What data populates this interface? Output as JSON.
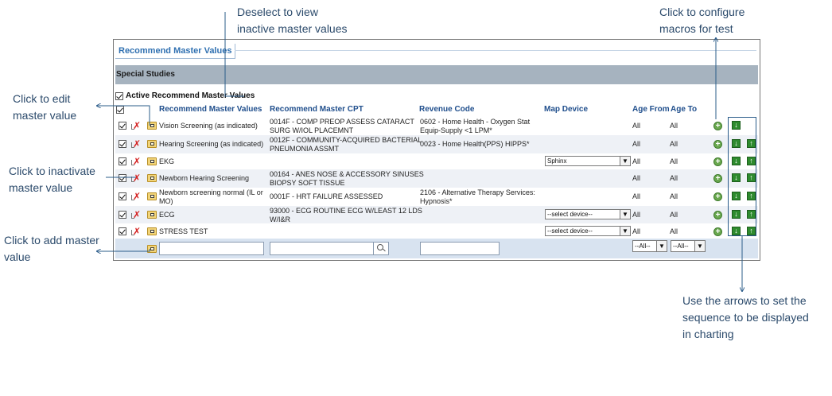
{
  "annotations": {
    "deselect": [
      "Deselect  to view",
      "inactive master values"
    ],
    "macros": [
      "Click to configure",
      "macros for test"
    ],
    "edit": [
      "Click to edit",
      "master value"
    ],
    "inactivate": [
      "Click to inactivate",
      "master value"
    ],
    "add": [
      "Click to add master",
      "value"
    ],
    "arrows": [
      "Use the arrows to set the",
      "sequence to be displayed",
      "in charting"
    ]
  },
  "panel": {
    "tab_title": "Recommend Master Values",
    "section_title": "Special Studies",
    "active_label": "Active Recommend Master Values"
  },
  "columns": {
    "values": "Recommend Master Values",
    "cpt": "Recommend Master CPT",
    "revenue": "Revenue Code",
    "device": "Map Device",
    "age_from": "Age From",
    "age_to": "Age To"
  },
  "rows": [
    {
      "name": "Vision Screening (as indicated)",
      "cpt": [
        "0014F - COMP PREOP ASSESS CATARACT",
        "SURG W/IOL PLACEMNT"
      ],
      "revenue": [
        "0602 - Home Health - Oxygen Stat",
        "Equip-Supply <1 LPM*"
      ],
      "device": "",
      "age_from": "All",
      "age_to": "All",
      "up": false,
      "down": true
    },
    {
      "name": "Hearing Screening (as indicated)",
      "cpt": [
        "0012F - COMMUNITY-ACQUIRED BACTERIAL",
        "PNEUMONIA ASSMT"
      ],
      "revenue": [
        "0023 - Home Health(PPS) HIPPS*",
        ""
      ],
      "device": "",
      "age_from": "All",
      "age_to": "All",
      "up": true,
      "down": true
    },
    {
      "name": "EKG",
      "cpt": [
        "",
        ""
      ],
      "revenue": [
        "",
        ""
      ],
      "device": "Sphinx",
      "age_from": "All",
      "age_to": "All",
      "up": true,
      "down": true
    },
    {
      "name": "Newborn Hearing Screening",
      "cpt": [
        "00164 - ANES NOSE & ACCESSORY SINUSES",
        "BIOPSY SOFT TISSUE"
      ],
      "revenue": [
        "",
        ""
      ],
      "device": "",
      "age_from": "All",
      "age_to": "All",
      "up": true,
      "down": true
    },
    {
      "name": "Newborn screening normal (IL or MO)",
      "cpt": [
        "0001F - HRT FAILURE ASSESSED",
        ""
      ],
      "revenue": [
        "2106 - Alternative Therapy Services:",
        "Hypnosis*"
      ],
      "device": "",
      "age_from": "All",
      "age_to": "All",
      "up": true,
      "down": true
    },
    {
      "name": "ECG",
      "cpt": [
        "93000 - ECG ROUTINE ECG W/LEAST 12 LDS",
        "W/I&R"
      ],
      "revenue": [
        "",
        ""
      ],
      "device": "--select device--",
      "age_from": "All",
      "age_to": "All",
      "up": true,
      "down": true
    },
    {
      "name": "STRESS TEST",
      "cpt": [
        "",
        ""
      ],
      "revenue": [
        "",
        ""
      ],
      "device": "--select device--",
      "age_from": "All",
      "age_to": "All",
      "up": true,
      "down": true
    }
  ],
  "add_row": {
    "age_from_default": "--All--",
    "age_to_default": "--All--"
  },
  "colors": {
    "accent": "#2f70b1",
    "header_bar": "#a6b3bf",
    "arrow_green": "#2e8b2e",
    "delete_red": "#d41f1f"
  }
}
